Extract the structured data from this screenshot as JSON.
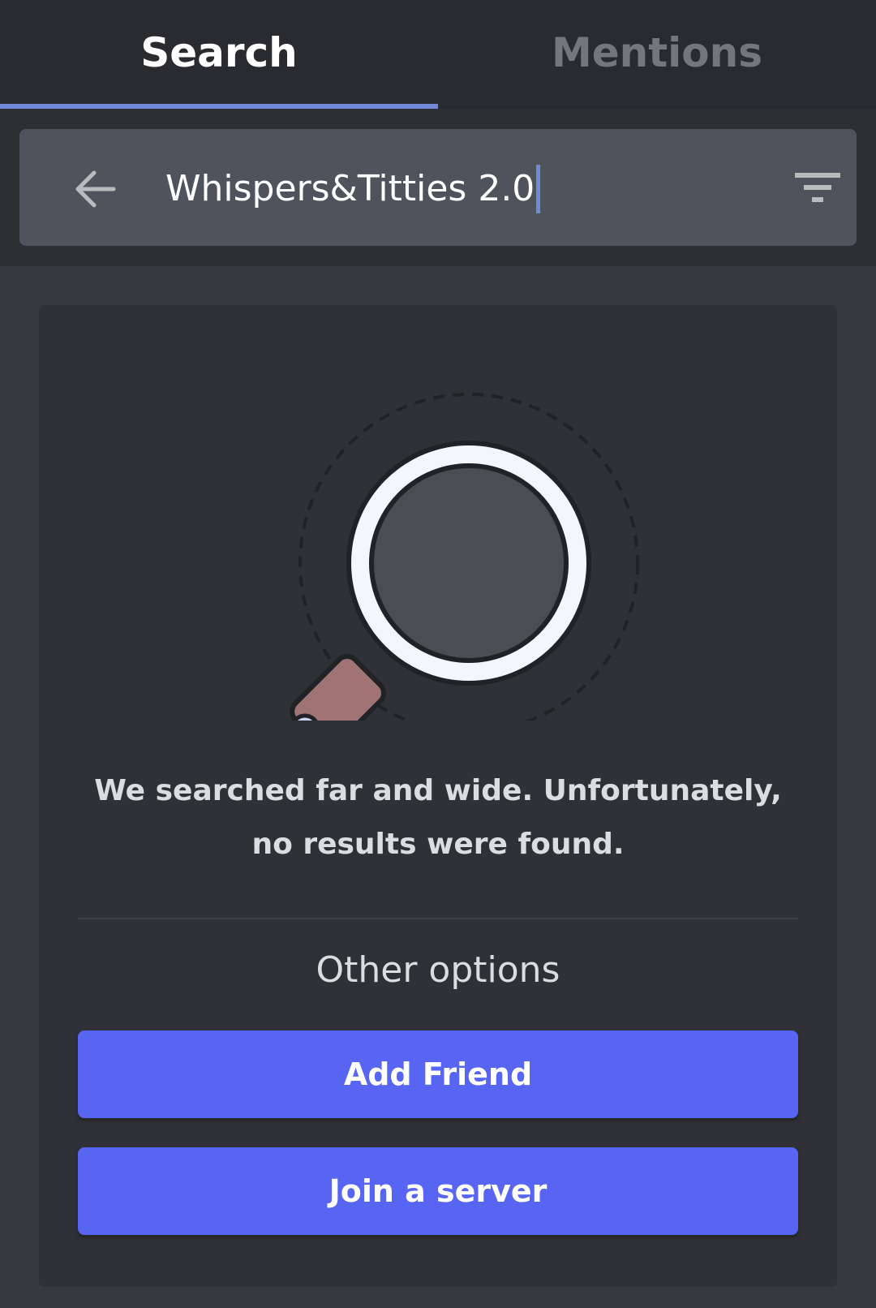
{
  "tabs": {
    "search_label": "Search",
    "mentions_label": "Mentions",
    "active": "Search"
  },
  "search": {
    "value": "Whispers&Titties 2.0",
    "back_icon": "arrow-left-icon",
    "filter_icon": "filter-icon"
  },
  "empty_state": {
    "illustration": "magnifying-glass-icon",
    "message_line1": "We searched far and wide. Unfortunately,",
    "message_line2": "no results were found."
  },
  "other_options": {
    "heading": "Other options",
    "add_friend_label": "Add Friend",
    "join_server_label": "Join a server"
  },
  "colors": {
    "accent_tab_indicator": "#7289da",
    "button": "#5865f2",
    "background": "#36393f",
    "card": "#2f3136",
    "search_bar": "#4f545c"
  }
}
